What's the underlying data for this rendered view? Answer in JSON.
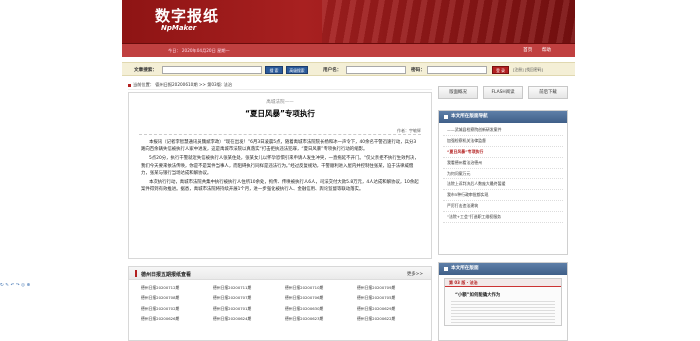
{
  "header": {
    "logo_cn": "数字报纸",
    "logo_en": "NpMaker",
    "date_text": "今日： 2020年04月20日 星期一",
    "links": [
      "首页",
      "帮助"
    ]
  },
  "search": {
    "article_label": "文章搜索：",
    "search_btn": "搜 索",
    "advanced_btn": "高级搜索",
    "user_label": "用户名：",
    "password_label": "密码：",
    "login_btn": "登 录",
    "register_link": "[注册] [找回密码]"
  },
  "breadcrumb": "当前位置： 德州日报20200610期 >> 第03版: 法治",
  "article": {
    "subtitle": "禹城法院——",
    "title": "“夏日风暴”专项执行",
    "author": "作者：宇敏辉",
    "paragraphs": [
      "本报讯（记者李智慧通讯员魏斌李政）“现在出发！”6月3日凌晨5点，随着禹城市法院院长杨和冰一声令下，40余名干警迅速行动，兵分3路向百余辆失信被执行人家中进发，这是禹城市法院以真落实“打击拒执违法犯罪，“夏日风暴”专项执行行动的缩影。",
      "5点20分，执行干警就近失信被执行人张某住处，张某女儿以怀孕恐惧引来申请人发生冲突，一直拖延不开门。“仅父亲拒不执行生效判决，我们今天要来依法传唤，你是不是案件当事人，而阻碍执行同样是违法行为。”经过反复规劝，干警顺利进入屋内并控制住张某，迫于法律威慑力，张某与银行当场达成和解协议。",
      "本次执行行动，禹城市法院共集中执行被执行人住所10余处，拘传、传唤被执行人6人，司法交付大款5.8万元，4人达成和解协议，10余起案件得到有效推进。据悉，禹城市法院将持续开展1个月，进一步强化被执行人、金融信用、舆论监督等联动落实。"
    ]
  },
  "more": {
    "title": "德州日报五期报纸查看",
    "link": "更多>>",
    "issues": [
      "德州日报20200712期",
      "德州日报20200711期",
      "德州日报20200710期",
      "德州日报20200709期",
      "德州日报20200708期",
      "德州日报20200707期",
      "德州日报20200706期",
      "德州日报20200705期",
      "德州日报20200702期",
      "德州日报20200701期",
      "德州日报20200630期",
      "德州日报20200629期",
      "德州日报20200626期",
      "德州日报20200624期",
      "德州日报20200623期",
      "德州日报20200622期"
    ]
  },
  "sidebar": {
    "tabs": [
      "版面概况",
      "FLASH阅读",
      "前后下载"
    ],
    "nav_title": "本文所在版面导航",
    "nav_items": [
      "——武城县检察院创新研发案件",
      "加强检察机关法律监督",
      "“夏日风暴”专项执行",
      "我看德州看法治德州",
      "为何问案万元",
      "法院上诉判决后人数庞大最终暂缓",
      "我市5种行政审批都实现",
      "严厉打击违法建筑",
      "“法院+工会”打造职工维权服务"
    ],
    "nav_active_index": 2,
    "page_title": "本文所在版面",
    "thumb_header": "第 03 版 · 法治",
    "thumb_headline": "“小额”如何能撬大作为"
  },
  "toolbar": {
    "glyphs": "↻✎↶↷◎⊕"
  }
}
